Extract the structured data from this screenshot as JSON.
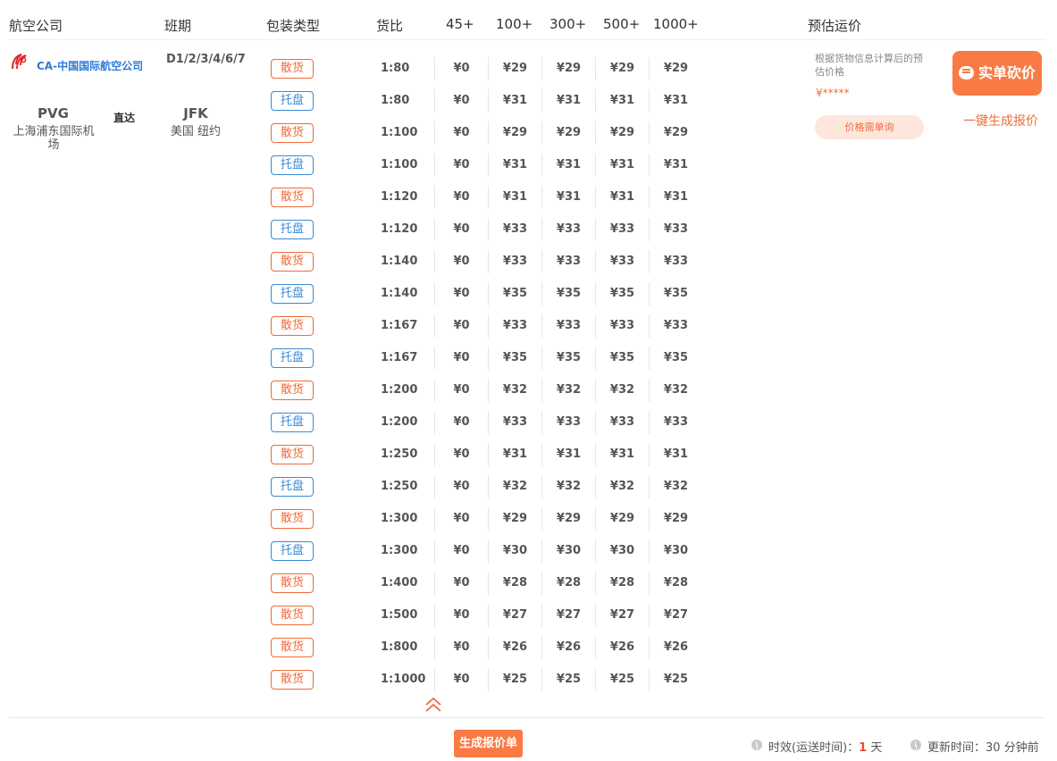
{
  "header": {
    "airline": "航空公司",
    "schedule": "班期",
    "package_type": "包装类型",
    "ratio": "货比",
    "w45": "45+",
    "w100": "100+",
    "w300": "300+",
    "w500": "500+",
    "w1000": "1000+",
    "estimate": "预估运价"
  },
  "airline": {
    "name": "CA-中国国际航空公司",
    "origin_code": "PVG",
    "origin_name": "上海浦东国际机场",
    "direct": "直达",
    "dest_code": "JFK",
    "dest_name": "美国 纽约",
    "schedule": "D1/2/3/4/6/7"
  },
  "rows": [
    {
      "type": "散货",
      "kind": "loose",
      "ratio": "1:80",
      "p45": "¥0",
      "p100": "¥29",
      "p300": "¥29",
      "p500": "¥29",
      "p1000": "¥29"
    },
    {
      "type": "托盘",
      "kind": "pallet",
      "ratio": "1:80",
      "p45": "¥0",
      "p100": "¥31",
      "p300": "¥31",
      "p500": "¥31",
      "p1000": "¥31"
    },
    {
      "type": "散货",
      "kind": "loose",
      "ratio": "1:100",
      "p45": "¥0",
      "p100": "¥29",
      "p300": "¥29",
      "p500": "¥29",
      "p1000": "¥29"
    },
    {
      "type": "托盘",
      "kind": "pallet",
      "ratio": "1:100",
      "p45": "¥0",
      "p100": "¥31",
      "p300": "¥31",
      "p500": "¥31",
      "p1000": "¥31"
    },
    {
      "type": "散货",
      "kind": "loose",
      "ratio": "1:120",
      "p45": "¥0",
      "p100": "¥31",
      "p300": "¥31",
      "p500": "¥31",
      "p1000": "¥31"
    },
    {
      "type": "托盘",
      "kind": "pallet",
      "ratio": "1:120",
      "p45": "¥0",
      "p100": "¥33",
      "p300": "¥33",
      "p500": "¥33",
      "p1000": "¥33"
    },
    {
      "type": "散货",
      "kind": "loose",
      "ratio": "1:140",
      "p45": "¥0",
      "p100": "¥33",
      "p300": "¥33",
      "p500": "¥33",
      "p1000": "¥33"
    },
    {
      "type": "托盘",
      "kind": "pallet",
      "ratio": "1:140",
      "p45": "¥0",
      "p100": "¥35",
      "p300": "¥35",
      "p500": "¥35",
      "p1000": "¥35"
    },
    {
      "type": "散货",
      "kind": "loose",
      "ratio": "1:167",
      "p45": "¥0",
      "p100": "¥33",
      "p300": "¥33",
      "p500": "¥33",
      "p1000": "¥33"
    },
    {
      "type": "托盘",
      "kind": "pallet",
      "ratio": "1:167",
      "p45": "¥0",
      "p100": "¥35",
      "p300": "¥35",
      "p500": "¥35",
      "p1000": "¥35"
    },
    {
      "type": "散货",
      "kind": "loose",
      "ratio": "1:200",
      "p45": "¥0",
      "p100": "¥32",
      "p300": "¥32",
      "p500": "¥32",
      "p1000": "¥32"
    },
    {
      "type": "托盘",
      "kind": "pallet",
      "ratio": "1:200",
      "p45": "¥0",
      "p100": "¥33",
      "p300": "¥33",
      "p500": "¥33",
      "p1000": "¥33"
    },
    {
      "type": "散货",
      "kind": "loose",
      "ratio": "1:250",
      "p45": "¥0",
      "p100": "¥31",
      "p300": "¥31",
      "p500": "¥31",
      "p1000": "¥31"
    },
    {
      "type": "托盘",
      "kind": "pallet",
      "ratio": "1:250",
      "p45": "¥0",
      "p100": "¥32",
      "p300": "¥32",
      "p500": "¥32",
      "p1000": "¥32"
    },
    {
      "type": "散货",
      "kind": "loose",
      "ratio": "1:300",
      "p45": "¥0",
      "p100": "¥29",
      "p300": "¥29",
      "p500": "¥29",
      "p1000": "¥29"
    },
    {
      "type": "托盘",
      "kind": "pallet",
      "ratio": "1:300",
      "p45": "¥0",
      "p100": "¥30",
      "p300": "¥30",
      "p500": "¥30",
      "p1000": "¥30"
    },
    {
      "type": "散货",
      "kind": "loose",
      "ratio": "1:400",
      "p45": "¥0",
      "p100": "¥28",
      "p300": "¥28",
      "p500": "¥28",
      "p1000": "¥28"
    },
    {
      "type": "散货",
      "kind": "loose",
      "ratio": "1:500",
      "p45": "¥0",
      "p100": "¥27",
      "p300": "¥27",
      "p500": "¥27",
      "p1000": "¥27"
    },
    {
      "type": "散货",
      "kind": "loose",
      "ratio": "1:800",
      "p45": "¥0",
      "p100": "¥26",
      "p300": "¥26",
      "p500": "¥26",
      "p1000": "¥26"
    },
    {
      "type": "散货",
      "kind": "loose",
      "ratio": "1:1000",
      "p45": "¥0",
      "p100": "¥25",
      "p300": "¥25",
      "p500": "¥25",
      "p1000": "¥25"
    }
  ],
  "estimate": {
    "note": "根据货物信息计算后的预估价格",
    "stars": "¥*****",
    "inquire": "价格需单询"
  },
  "actions": {
    "bargain": "实单砍价",
    "generate_link": "一键生成报价",
    "generate_button": "生成报价单"
  },
  "footer": {
    "transit_label": "时效(运送时间)：",
    "transit_days": "1",
    "transit_unit": "天",
    "updated_label": "更新时间：",
    "updated_value": "30 分钟前"
  },
  "colors": {
    "accent": "#f97a45",
    "loose_tag": "#f06b3a",
    "pallet_tag": "#3a8ad4",
    "airline_link": "#2f7ad9"
  }
}
